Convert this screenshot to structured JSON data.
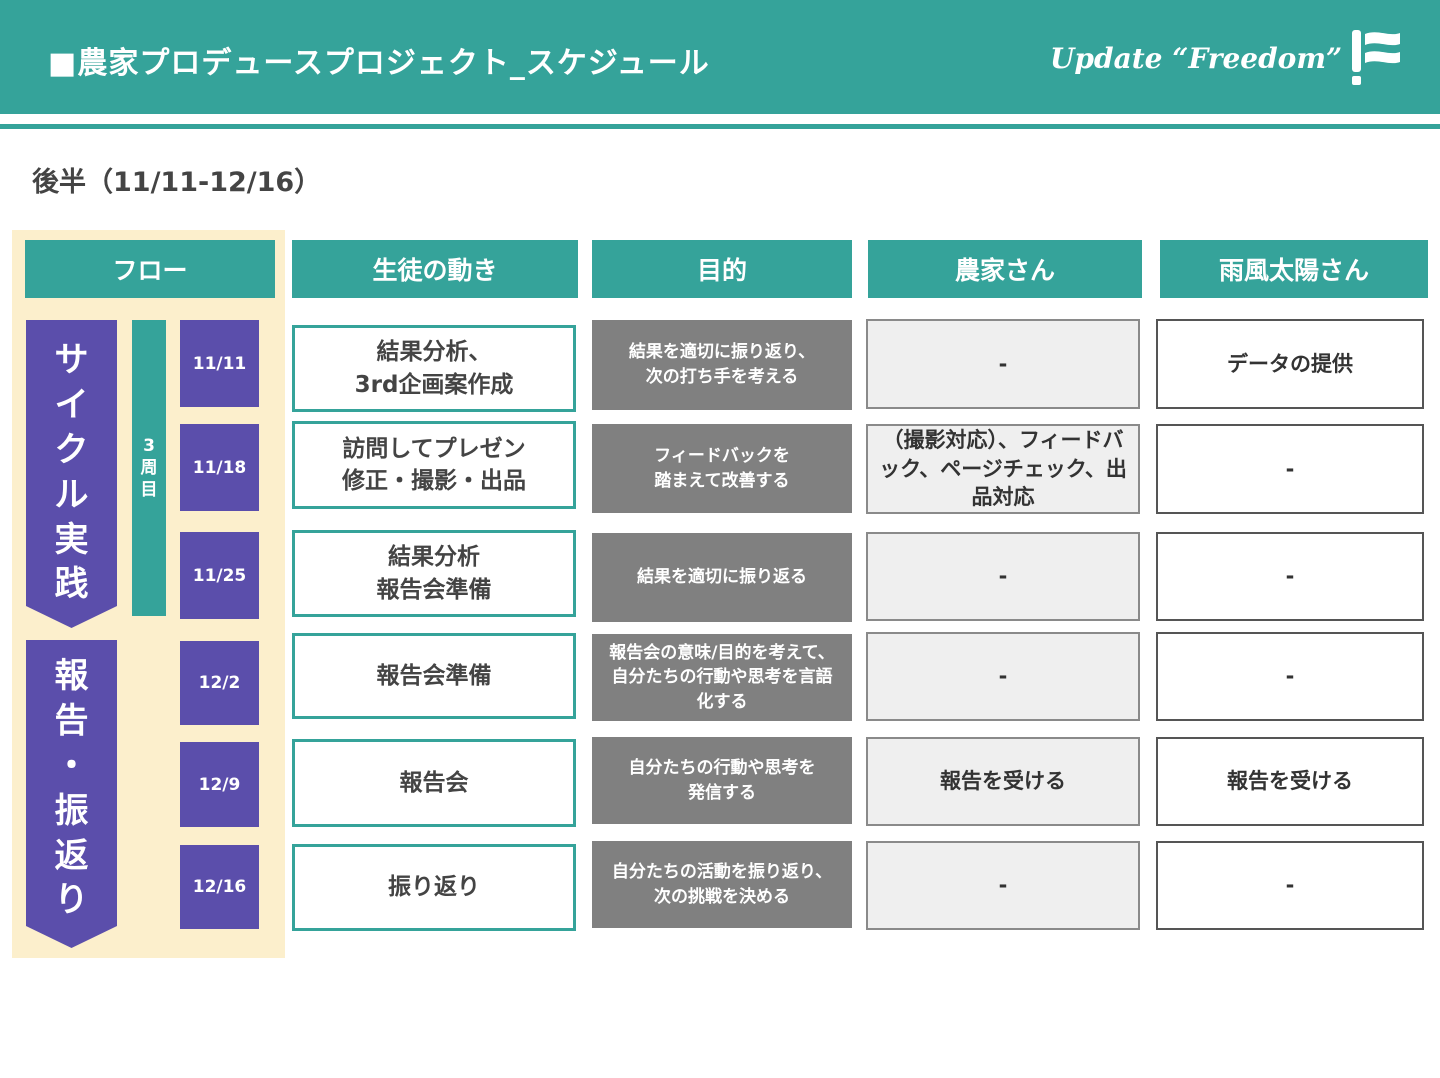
{
  "header": {
    "title": "■農家プロデュースプロジェクト_スケジュール",
    "tagline": "Update “Freedom”"
  },
  "subtitle": "後半（11/11-12/16）",
  "columns": {
    "flow": "フロー",
    "students": "生徒の動き",
    "purpose": "目的",
    "farmer": "農家さん",
    "amekaze": "雨風太陽さん"
  },
  "phases": [
    {
      "chars": [
        "サ",
        "イ",
        "ク",
        "ル",
        "実",
        "践"
      ]
    },
    {
      "chars": [
        "報",
        "告",
        "・",
        "振",
        "返",
        "り"
      ]
    }
  ],
  "week_label": [
    "3",
    "周",
    "目"
  ],
  "rows": [
    {
      "date": "11/11",
      "student": "結果分析、\n3rd企画案作成",
      "purpose": "結果を適切に振り返り、\n次の打ち手を考える",
      "farmer": "-",
      "amekaze": "データの提供"
    },
    {
      "date": "11/18",
      "student": "訪問してプレゼン\n修正・撮影・出品",
      "purpose": "フィードバックを\n踏まえて改善する",
      "farmer": "（撮影対応）、フィードバック、ページチェック、出品対応",
      "amekaze": "-"
    },
    {
      "date": "11/25",
      "student": "結果分析\n報告会準備",
      "purpose": "結果を適切に振り返る",
      "farmer": "-",
      "amekaze": "-"
    },
    {
      "date": "12/2",
      "student": "報告会準備",
      "purpose": "報告会の意味/目的を考えて、自分たちの行動や思考を言語化する",
      "farmer": "-",
      "amekaze": "-"
    },
    {
      "date": "12/9",
      "student": "報告会",
      "purpose": "自分たちの行動や思考を\n発信する",
      "farmer": "報告を受ける",
      "amekaze": "報告を受ける"
    },
    {
      "date": "12/16",
      "student": "振り返り",
      "purpose": "自分たちの活動を振り返り、次の挑戦を決める",
      "farmer": "-",
      "amekaze": "-"
    }
  ],
  "colors": {
    "teal": "#35a39a",
    "purple": "#5b4eab",
    "cream": "#fcefcc",
    "gray": "#808080",
    "light_gray": "#efefef"
  }
}
